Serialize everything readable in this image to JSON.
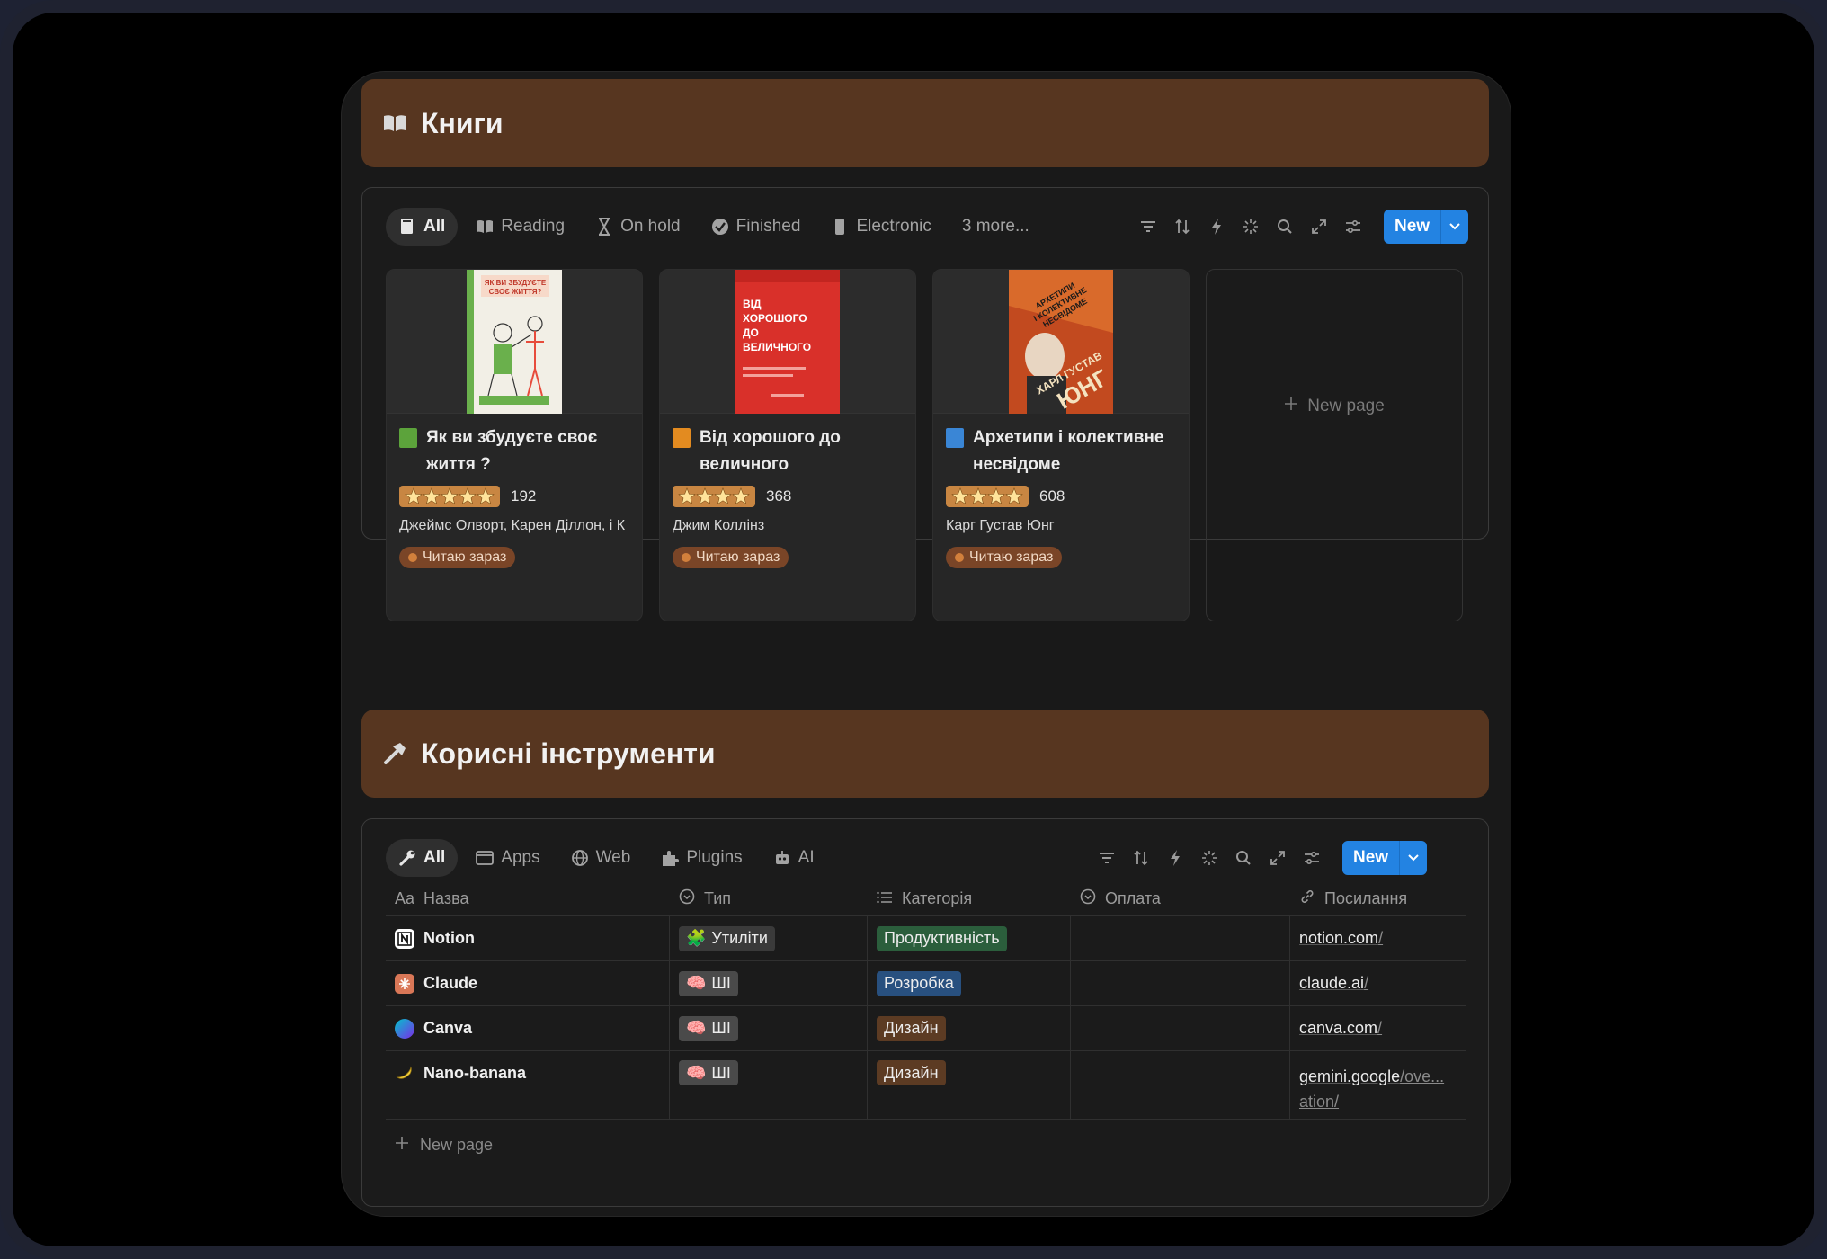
{
  "books_section": {
    "title": "Книги",
    "tabs": [
      {
        "label": "All",
        "icon": "book-stack-icon",
        "active": true
      },
      {
        "label": "Reading",
        "icon": "open-book-icon"
      },
      {
        "label": "On hold",
        "icon": "hourglass-icon"
      },
      {
        "label": "Finished",
        "icon": "check-circle-icon"
      },
      {
        "label": "Electronic",
        "icon": "phone-icon"
      },
      {
        "label": "3 more..."
      }
    ],
    "new_button": "New",
    "cards": [
      {
        "title": "Як ви збудуєте своє життя ?",
        "icon_color": "#5ca33b",
        "stars": 5,
        "pages": "192",
        "author": "Джеймс Олворт, Карен Діллон, і К",
        "status": "Читаю зараз"
      },
      {
        "title": "Від хорошого до величного",
        "icon_color": "#e38b20",
        "stars": 4,
        "pages": "368",
        "author": "Джим Коллінз",
        "status": "Читаю зараз"
      },
      {
        "title": "Архетипи і колективне несвідоме",
        "icon_color": "#3a86d6",
        "stars": 4,
        "pages": "608",
        "author": "Карг Густав Юнг",
        "status": "Читаю зараз"
      }
    ],
    "covers": {
      "book1": "ЯК ВИ ЗБУДУЄТЕ СВОЄ ЖИТТЯ?",
      "book2_lines": [
        "ВІД",
        "ХОРОШОГО",
        "ДО",
        "ВЕЛИЧНОГО"
      ],
      "book3_top": "АРХЕТИПИ І КОЛЕКТИВНЕ НЕСВІДОМЕ",
      "book3_author": "ХАРЛ ГУСТАВ ЮНГ"
    },
    "new_page": "New page"
  },
  "tools_section": {
    "title": "Корисні інструменти",
    "tabs": [
      {
        "label": "All",
        "icon": "wrench-icon",
        "active": true
      },
      {
        "label": "Apps",
        "icon": "window-icon"
      },
      {
        "label": "Web",
        "icon": "globe-icon"
      },
      {
        "label": "Plugins",
        "icon": "puzzle-icon"
      },
      {
        "label": "AI",
        "icon": "robot-icon"
      }
    ],
    "new_button": "New",
    "columns": {
      "name": "Назва",
      "name_prefix": "Aa",
      "type": "Тип",
      "category": "Категорія",
      "payment": "Оплата",
      "link": "Посилання"
    },
    "rows": [
      {
        "name": "Notion",
        "type": "Утиліти",
        "type_emoji": "🧩",
        "category": "Продуктивність",
        "category_color": "#2b5e3c",
        "link_main": "notion.com",
        "link_rest": "/"
      },
      {
        "name": "Claude",
        "type": "ШІ",
        "type_emoji": "🧠",
        "category": "Розробка",
        "category_color": "#28507f",
        "link_main": "claude.ai",
        "link_rest": "/"
      },
      {
        "name": "Canva",
        "type": "ШІ",
        "type_emoji": "🧠",
        "category": "Дизайн",
        "category_color": "#5c3b23",
        "link_main": "canva.com",
        "link_rest": "/"
      },
      {
        "name": "Nano-banana",
        "type": "ШІ",
        "type_emoji": "🧠",
        "category": "Дизайн",
        "category_color": "#5c3b23",
        "link_main": "gemini.google",
        "link_rest": "/ove...",
        "link_line2": "ation/"
      }
    ],
    "new_page": "New page"
  }
}
